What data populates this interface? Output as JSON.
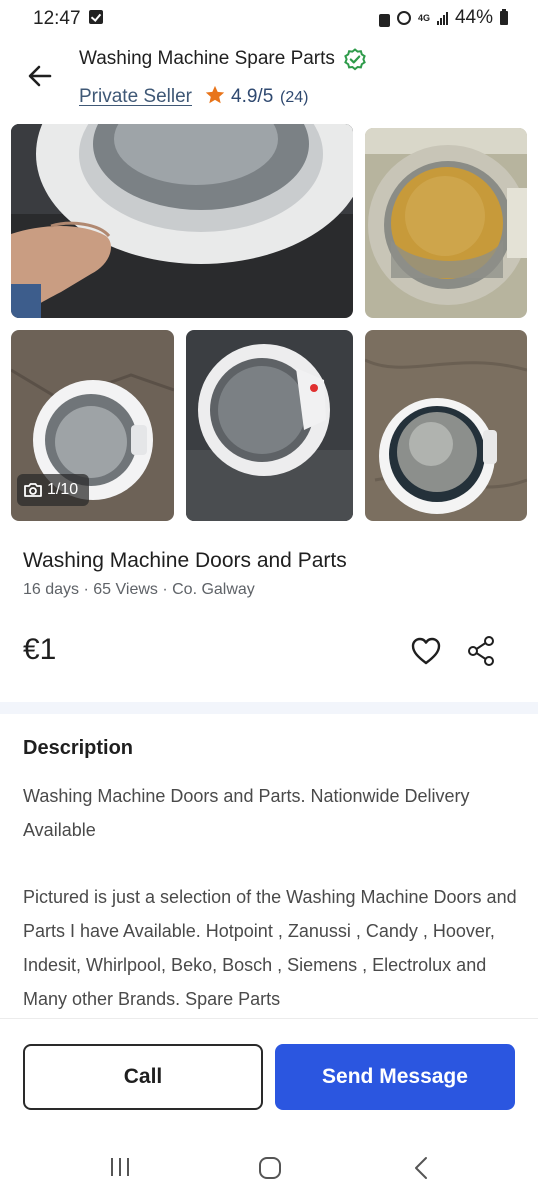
{
  "status_bar": {
    "time": "12:47",
    "network": "4G",
    "battery": "44%"
  },
  "header": {
    "seller_name": "Washing Machine Spare Parts",
    "seller_type": "Private Seller",
    "rating": "4.9/5",
    "reviews": "(24)",
    "star_color": "#e8741a",
    "verified_color": "#2e9b4a"
  },
  "gallery": {
    "counter": "1/10",
    "icons": [
      "camera-icon"
    ]
  },
  "listing": {
    "title": "Washing Machine Doors and Parts",
    "meta": "16 days · 65 Views · Co. Galway",
    "price": "€1"
  },
  "description": {
    "heading": "Description",
    "paragraph_1": "Washing Machine Doors and Parts. Nationwide Delivery Available",
    "paragraph_2": "Pictured is just a selection of the Washing Machine Doors and Parts I have Available. Hotpoint , Zanussi , Candy , Hoover, Indesit, Whirlpool, Beko, Bosch , Siemens , Electrolux and Many other Brands. Spare Parts"
  },
  "actions": {
    "call_label": "Call",
    "message_label": "Send Message",
    "accent": "#2b56e0"
  }
}
